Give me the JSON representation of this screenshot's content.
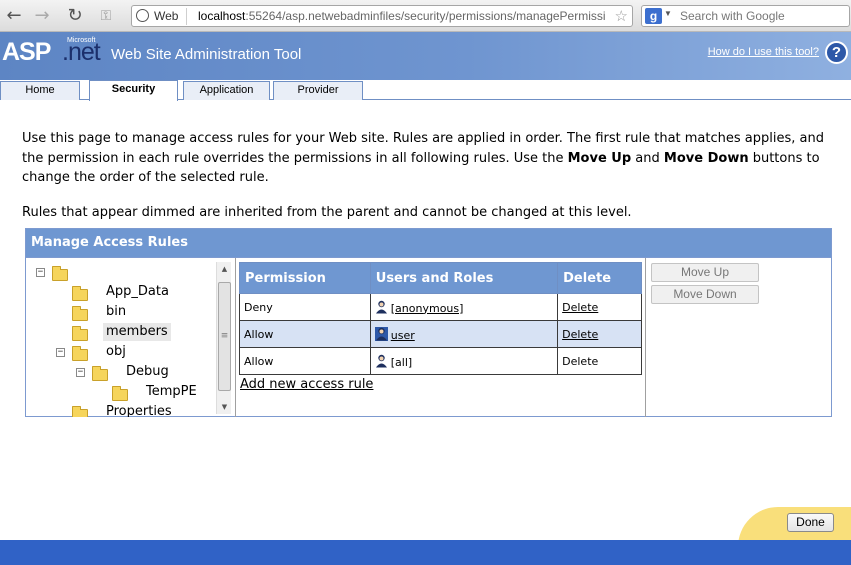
{
  "browser": {
    "web_label": "Web",
    "url_host": "localhost",
    "url_rest": ":55264/asp.netwebadminfiles/security/permissions/managePermissi",
    "search_placeholder": "Search with Google"
  },
  "header": {
    "logo_asp": "ASP",
    "logo_net": ".net",
    "logo_ms": "Microsoft",
    "title": "Web Site Administration Tool",
    "help_link": "How do I use this tool?",
    "help_icon": "?"
  },
  "tabs": [
    {
      "label": "Home"
    },
    {
      "label": "Security"
    },
    {
      "label": "Application"
    },
    {
      "label": "Provider"
    }
  ],
  "intro": {
    "p1_a": "Use this page to manage access rules for your Web site. Rules are applied in order. The first rule that matches applies, and the permission in each rule overrides the permissions in all following rules. Use the ",
    "p1_move_up": "Move Up",
    "p1_and": " and ",
    "p1_move_down": "Move Down",
    "p1_b": " buttons to change the order of the selected rule.",
    "p2": "Rules that appear dimmed are inherited from the parent and cannot be changed at this level."
  },
  "panel": {
    "title": "Manage Access Rules"
  },
  "tree": [
    {
      "label": ""
    },
    {
      "label": "App_Data"
    },
    {
      "label": "bin"
    },
    {
      "label": "members"
    },
    {
      "label": "obj"
    },
    {
      "label": "Debug"
    },
    {
      "label": "TempPE"
    },
    {
      "label": "Properties"
    }
  ],
  "rules": {
    "headers": [
      "Permission",
      "Users and Roles",
      "Delete"
    ],
    "rows": [
      {
        "permission": "Deny",
        "user": "[anonymous]",
        "delete": "Delete"
      },
      {
        "permission": "Allow",
        "user": "user",
        "delete": "Delete"
      },
      {
        "permission": "Allow",
        "user": "[all]",
        "delete": "Delete"
      }
    ],
    "add_link": "Add new access rule"
  },
  "buttons": {
    "move_up": "Move Up",
    "move_down": "Move Down",
    "done": "Done"
  },
  "colors": {
    "header_blue": "#6f97d1",
    "selected_row": "#d7e2f4",
    "footer_blue": "#3062c6",
    "done_wave": "#f9df7b"
  },
  "icons": {
    "back": "back-arrow-icon",
    "forward": "forward-arrow-icon",
    "reload": "reload-icon",
    "key": "key-icon",
    "star": "star-icon",
    "folder": "folder-icon",
    "user": "user-icon",
    "help": "help-icon"
  }
}
